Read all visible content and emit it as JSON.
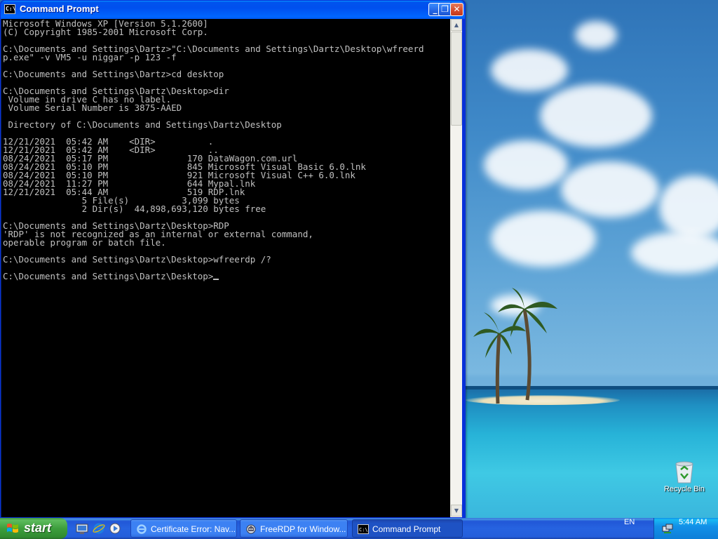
{
  "window": {
    "title": "Command Prompt",
    "icon": "cmd-icon",
    "icon_text": "C:\\",
    "minimize": "_",
    "maximize": "❐",
    "close": "✕"
  },
  "console": {
    "lines": [
      "Microsoft Windows XP [Version 5.1.2600]",
      "(C) Copyright 1985-2001 Microsoft Corp.",
      "",
      "C:\\Documents and Settings\\Dartz>\"C:\\Documents and Settings\\Dartz\\Desktop\\wfreerd",
      "p.exe\" -v VM5 -u niggar -p 123 -f",
      "",
      "C:\\Documents and Settings\\Dartz>cd desktop",
      "",
      "C:\\Documents and Settings\\Dartz\\Desktop>dir",
      " Volume in drive C has no label.",
      " Volume Serial Number is 3875-AAED",
      "",
      " Directory of C:\\Documents and Settings\\Dartz\\Desktop",
      "",
      "12/21/2021  05:42 AM    <DIR>          .",
      "12/21/2021  05:42 AM    <DIR>          ..",
      "08/24/2021  05:17 PM               170 DataWagon.com.url",
      "08/24/2021  05:10 PM               845 Microsoft Visual Basic 6.0.lnk",
      "08/24/2021  05:10 PM               921 Microsoft Visual C++ 6.0.lnk",
      "08/24/2021  11:27 PM               644 Mypal.lnk",
      "12/21/2021  05:44 AM               519 RDP.lnk",
      "               5 File(s)          3,099 bytes",
      "               2 Dir(s)  44,898,693,120 bytes free",
      "",
      "C:\\Documents and Settings\\Dartz\\Desktop>RDP",
      "'RDP' is not recognized as an internal or external command,",
      "operable program or batch file.",
      "",
      "C:\\Documents and Settings\\Dartz\\Desktop>wfreerdp /?",
      ""
    ],
    "prompt": "C:\\Documents and Settings\\Dartz\\Desktop>"
  },
  "scrollbar": {
    "up": "▲",
    "down": "▼"
  },
  "desktop": {
    "recycle_bin_label": "Recycle Bin"
  },
  "taskbar": {
    "start_label": "start",
    "quick_launch": [
      "show-desktop-icon",
      "internet-explorer-icon",
      "media-player-icon"
    ],
    "tasks": [
      {
        "label": "Certificate Error: Nav...",
        "icon": "internet-explorer-icon"
      },
      {
        "label": "FreeRDP for Window...",
        "icon": "freerdp-icon"
      },
      {
        "label": "Command Prompt",
        "icon": "cmd-icon",
        "active": true
      }
    ],
    "language": "EN",
    "clock": "5:44 AM"
  },
  "colors": {
    "titlebar": "#0058ee",
    "console_bg": "#000000",
    "console_fg": "#c0c0c0",
    "taskbar": "#245edb",
    "start": "#3d9e3d"
  }
}
